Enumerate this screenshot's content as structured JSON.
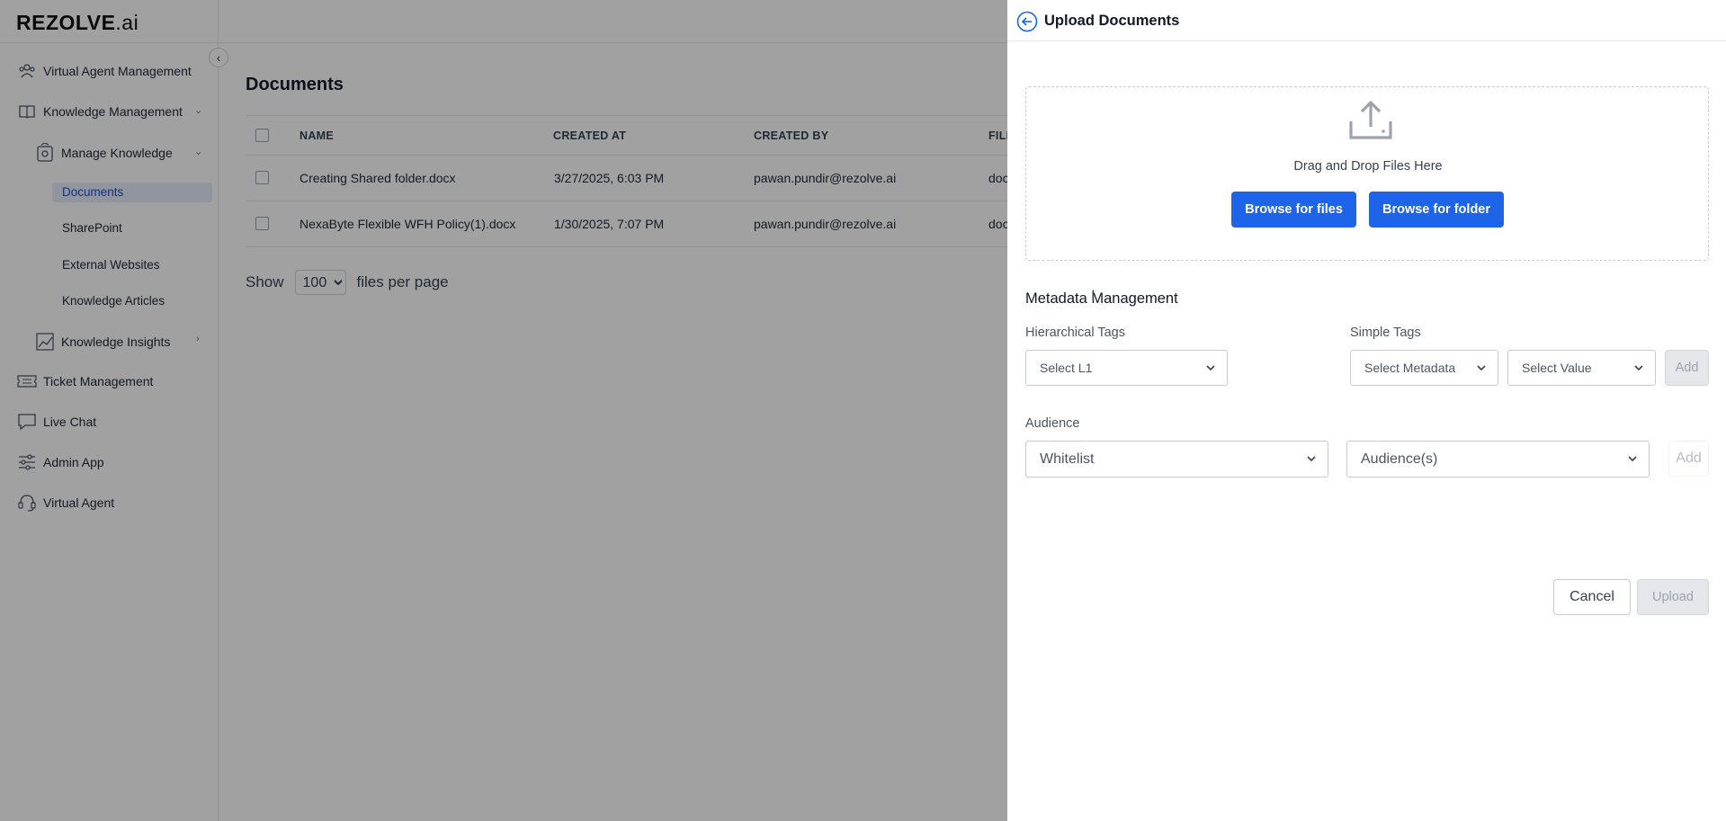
{
  "app": {
    "logo_text": "REZOLVE",
    "logo_suffix": ".ai"
  },
  "sidebar": {
    "items": [
      {
        "label": "Virtual Agent Management",
        "icon": "people-icon"
      },
      {
        "label": "Knowledge Management",
        "icon": "book-icon"
      },
      {
        "label": "Manage Knowledge",
        "icon": "knowledge-icon"
      },
      {
        "label": "Knowledge Insights",
        "icon": "chart-icon"
      },
      {
        "label": "Ticket Management",
        "icon": "ticket-icon"
      },
      {
        "label": "Live Chat",
        "icon": "chat-icon"
      },
      {
        "label": "Admin App",
        "icon": "sliders-icon"
      },
      {
        "label": "Virtual Agent",
        "icon": "headset-icon"
      }
    ],
    "sub_items": [
      "Documents",
      "SharePoint",
      "External Websites",
      "Knowledge Articles"
    ]
  },
  "documents": {
    "title": "Documents",
    "columns": [
      "NAME",
      "CREATED AT",
      "CREATED BY",
      "FILE"
    ],
    "rows": [
      {
        "name": "Creating Shared folder.docx",
        "created_at": "3/27/2025, 6:03 PM",
        "created_by": "pawan.pundir@rezolve.ai",
        "file": "doc"
      },
      {
        "name": "NexaByte Flexible WFH Policy(1).docx",
        "created_at": "1/30/2025, 7:07 PM",
        "created_by": "pawan.pundir@rezolve.ai",
        "file": "doc"
      }
    ],
    "pager": {
      "show": "Show",
      "per_page_value": "100",
      "suffix": "files per page"
    }
  },
  "drawer": {
    "title": "Upload Documents",
    "drop_text": "Drag and Drop Files Here",
    "browse_files": "Browse for files",
    "browse_folder": "Browse for folder",
    "metadata_title": "Metadata Management",
    "hierarchical_label": "Hierarchical Tags",
    "select_l1": "Select L1",
    "simple_label": "Simple Tags",
    "select_metadata": "Select Metadata",
    "select_value": "Select Value",
    "add_label": "Add",
    "audience_label": "Audience",
    "audience_type": "Whitelist",
    "audiences_placeholder": "Audience(s)",
    "cancel": "Cancel",
    "upload": "Upload"
  },
  "colors": {
    "primary": "#1d64e8",
    "active_nav_bg": "#e6eefb",
    "active_nav_text": "#1d4ed8",
    "overlay": "rgba(0,0,0,0.37)"
  }
}
